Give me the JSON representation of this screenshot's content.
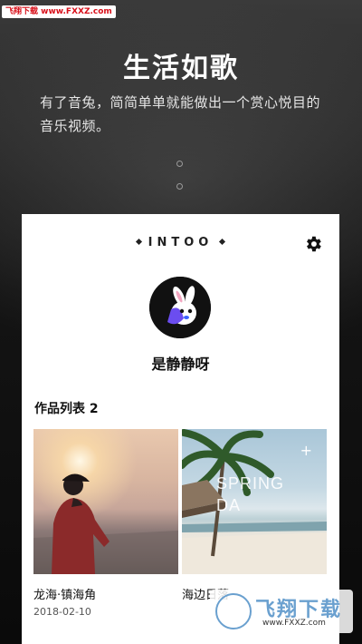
{
  "watermark_top": "飞翔下载 www.FXXZ.com",
  "onboarding": {
    "headline": "生活如歌",
    "description": "有了音兔，简简单单就能做出一个赏心悦目的音乐视频。"
  },
  "card": {
    "brand": "INTOO",
    "settings_icon": "gear-icon",
    "username": "是静静呀",
    "works_title": "作品列表 2",
    "works": [
      {
        "title": "龙海·镇海角",
        "date": "2018-02-10",
        "overlay_text": ""
      },
      {
        "title": "海边日落",
        "date": "",
        "overlay_text": "SPRING DA"
      }
    ]
  },
  "watermark_bottom": {
    "brand": "飞翔下载",
    "url": "www.FXXZ.com"
  }
}
